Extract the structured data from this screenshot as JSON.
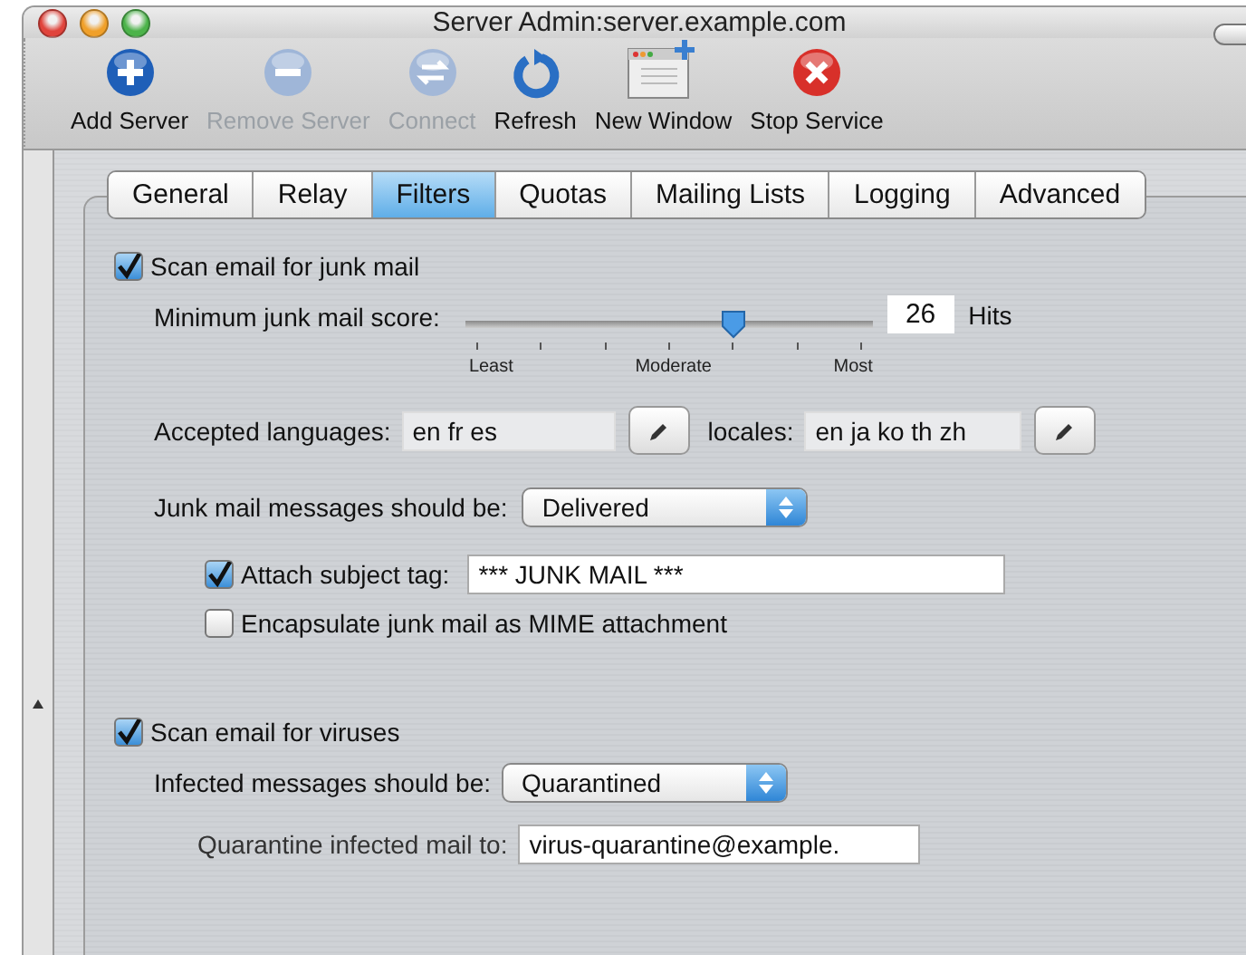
{
  "window": {
    "title": "Server Admin:server.example.com"
  },
  "toolbar": [
    {
      "label": "Add Server",
      "kind": "add",
      "disabled": false
    },
    {
      "label": "Remove Server",
      "kind": "remove",
      "disabled": true
    },
    {
      "label": "Connect",
      "kind": "connect",
      "disabled": true
    },
    {
      "label": "Refresh",
      "kind": "refresh",
      "disabled": false
    },
    {
      "label": "New Window",
      "kind": "new-window",
      "disabled": false
    },
    {
      "label": "Stop Service",
      "kind": "stop",
      "disabled": false
    }
  ],
  "tabs": [
    {
      "label": "General",
      "selected": false
    },
    {
      "label": "Relay",
      "selected": false
    },
    {
      "label": "Filters",
      "selected": true
    },
    {
      "label": "Quotas",
      "selected": false
    },
    {
      "label": "Mailing Lists",
      "selected": false
    },
    {
      "label": "Logging",
      "selected": false
    },
    {
      "label": "Advanced",
      "selected": false
    }
  ],
  "junk": {
    "scan": {
      "label": "Scan email for junk mail",
      "checked": true
    },
    "score": {
      "label": "Minimum junk mail score:",
      "level": 0.66,
      "ticks": [
        "Least",
        "Moderate",
        "Most"
      ],
      "value": "26",
      "unit": "Hits"
    },
    "languages": {
      "label": "Accepted languages:",
      "value": "en fr es"
    },
    "locales": {
      "label": "locales:",
      "value": "en ja ko th zh"
    },
    "disposition": {
      "label": "Junk mail messages should be:",
      "value": "Delivered"
    },
    "subject_tag": {
      "label": "Attach subject tag:",
      "checked": true,
      "value": "*** JUNK MAIL ***"
    },
    "encapsulate": {
      "label": "Encapsulate junk mail as MIME attachment",
      "checked": false
    }
  },
  "virus": {
    "scan": {
      "label": "Scan email for viruses",
      "checked": true
    },
    "disposition": {
      "label": "Infected messages should be:",
      "value": "Quarantined"
    },
    "quarantine": {
      "label": "Quarantine infected mail to:",
      "value": "virus-quarantine@example."
    }
  }
}
